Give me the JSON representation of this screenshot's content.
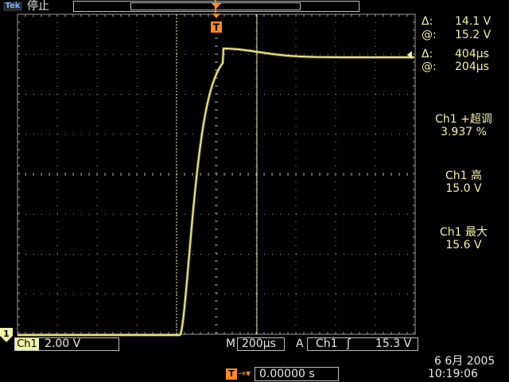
{
  "top_bar": {
    "logo_text": "Tek",
    "run_state": "停止"
  },
  "trigger_marker": {
    "label": "T"
  },
  "cursor_readouts": {
    "delta_volts_symbol": "Δ:",
    "delta_volts": "14.1 V",
    "at_volts_symbol": "@:",
    "at_volts": "15.2 V",
    "delta_time_symbol": "Δ:",
    "delta_time": "404µs",
    "at_time_symbol": "@:",
    "at_time": "204µs"
  },
  "measurements": [
    {
      "label": "Ch1 +超调",
      "value": "3.937 %"
    },
    {
      "label": "Ch1 高",
      "value": "15.0 V"
    },
    {
      "label": "Ch1 最大",
      "value": "15.6 V"
    }
  ],
  "bottom_bar": {
    "channel_marker": "1",
    "channel_tag": "Ch1",
    "channel_scale": "2.00 V",
    "main_label": "M",
    "main_timebase": "200µs",
    "trigger_label": "A",
    "trigger_source": "Ch1",
    "trigger_slope": "ʃ",
    "trigger_level": "15.3 V",
    "trigger_pos_icon": "T",
    "trigger_pos_arrow": "→▾",
    "trigger_pos_value": "0.00000 s",
    "date": "6 6月  2005",
    "time": "10:19:06"
  },
  "colors": {
    "trace": "#e6e07a",
    "readout": "#f2f2a6",
    "trigger_marker": "#ff8a1a",
    "graticule": "#9a9a9a",
    "cursor": "#f2f2a6"
  },
  "icons": {
    "logo": "tek-logo-icon",
    "trigger": "trigger-t-icon",
    "channel_ground": "ground-marker-icon",
    "waveform_level": "level-arrow-icon"
  }
}
